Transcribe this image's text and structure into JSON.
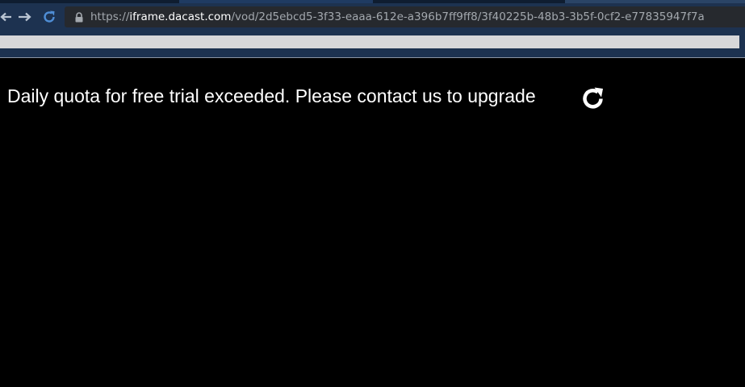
{
  "browser": {
    "url": {
      "scheme": "https://",
      "domain": "iframe.dacast.com",
      "path": "/vod/2d5ebcd5-3f33-eaaa-612e-a396b7ff9ff8/3f40225b-48b3-3b5f-0cf2-e77835947f7a"
    },
    "icons": {
      "back": "arrow-left-icon",
      "forward": "arrow-right-icon",
      "reload": "reload-icon",
      "secure": "lock-icon"
    },
    "colors": {
      "chrome_bg": "#1d3250",
      "address_bg": "#26292e",
      "bookmarks_bg": "#d7d7d9"
    }
  },
  "player": {
    "message": "Daily quota for free trial exceeded. Please contact us to upgrade",
    "refresh_icon": "refresh-icon",
    "colors": {
      "background": "#000000",
      "text": "#ffffff"
    }
  }
}
